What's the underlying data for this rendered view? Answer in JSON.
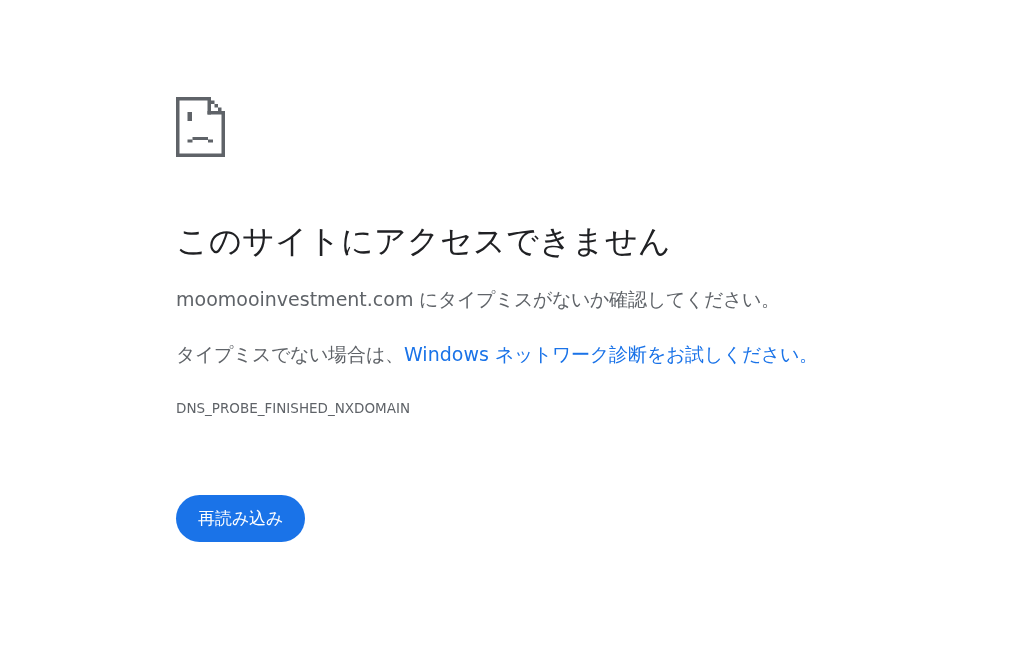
{
  "title": "このサイトにアクセスできません",
  "message": "moomooinvestment.com にタイプミスがないか確認してください。",
  "suggestion": {
    "text": "タイプミスでない場合は、",
    "link": "Windows ネットワーク診断をお試しください。"
  },
  "error_code": "DNS_PROBE_FINISHED_NXDOMAIN",
  "reload_button": "再読み込み"
}
